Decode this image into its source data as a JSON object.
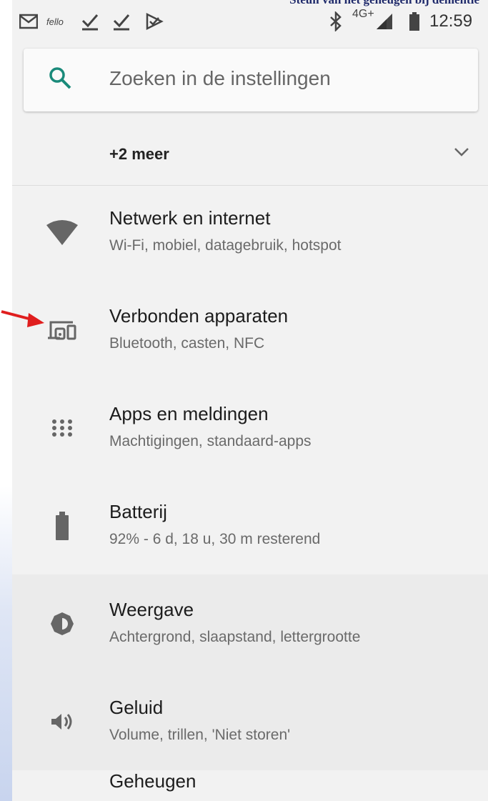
{
  "caption": "Steun van het geheugen bij dementie",
  "statusbar": {
    "icons": [
      "gmail-icon",
      "fello-icon",
      "check-icon",
      "check-icon",
      "doublecheck-icon",
      "bluetooth-icon",
      "signal-icon",
      "battery-icon"
    ],
    "app_label": "fello",
    "network": "4G+",
    "time": "12:59"
  },
  "search": {
    "placeholder": "Zoeken in de instellingen"
  },
  "more": {
    "label": "+2 meer"
  },
  "items": [
    {
      "icon": "wifi-icon",
      "title": "Netwerk en internet",
      "subtitle": "Wi-Fi, mobiel, datagebruik, hotspot"
    },
    {
      "icon": "connected-devices-icon",
      "title": "Verbonden apparaten",
      "subtitle": "Bluetooth, casten, NFC"
    },
    {
      "icon": "apps-icon",
      "title": "Apps en meldingen",
      "subtitle": "Machtigingen, standaard-apps"
    },
    {
      "icon": "battery-icon",
      "title": "Batterij",
      "subtitle": "92% - 6 d, 18 u, 30 m resterend"
    },
    {
      "icon": "brightness-icon",
      "title": "Weergave",
      "subtitle": "Achtergrond, slaapstand, lettergrootte"
    },
    {
      "icon": "volume-icon",
      "title": "Geluid",
      "subtitle": "Volume, trillen, 'Niet storen'"
    }
  ],
  "partial_item": {
    "title": "Geheugen"
  },
  "colors": {
    "accent": "#1a8a7a",
    "arrow": "#e01e1e",
    "background": "#f2f2f2"
  }
}
